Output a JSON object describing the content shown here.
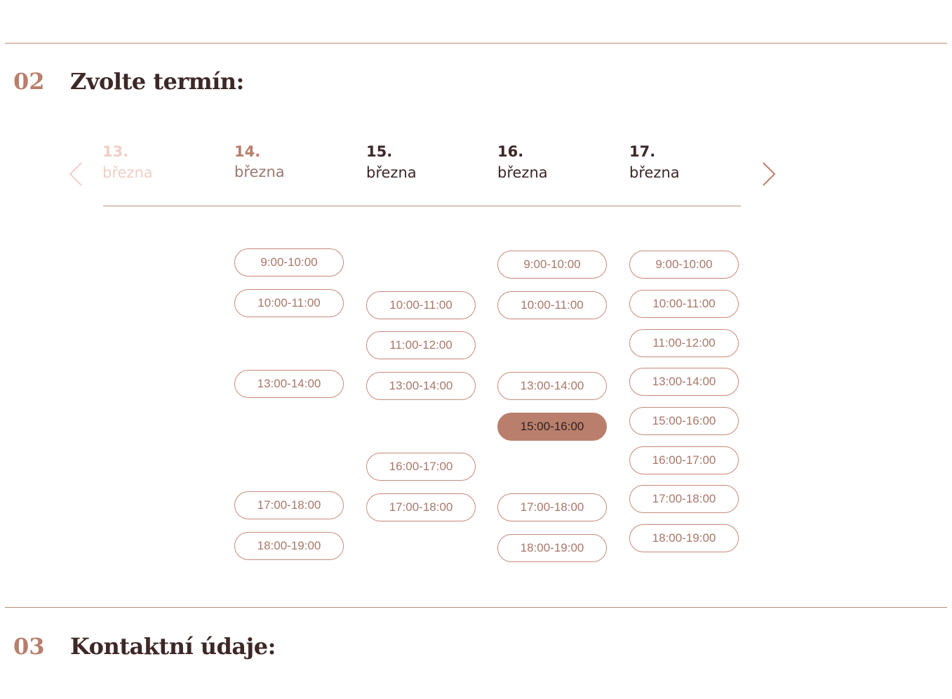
{
  "section2": {
    "number": "02",
    "title": "Zvolte termín:"
  },
  "section3": {
    "number": "03",
    "title": "Kontaktní údaje:"
  },
  "days": [
    {
      "num": "13.",
      "month": "března",
      "state": "disabled"
    },
    {
      "num": "14.",
      "month": "března",
      "state": "muted"
    },
    {
      "num": "15.",
      "month": "března",
      "state": "active"
    },
    {
      "num": "16.",
      "month": "března",
      "state": "active"
    },
    {
      "num": "17.",
      "month": "března",
      "state": "active"
    }
  ],
  "slots": {
    "day14": [
      "9:00-10:00",
      "10:00-11:00",
      "13:00-14:00",
      "17:00-18:00",
      "18:00-19:00"
    ],
    "day15": [
      "10:00-11:00",
      "11:00-12:00",
      "13:00-14:00",
      "16:00-17:00",
      "17:00-18:00"
    ],
    "day16": [
      "9:00-10:00",
      "10:00-11:00",
      "13:00-14:00",
      "15:00-16:00",
      "17:00-18:00",
      "18:00-19:00"
    ],
    "day17": [
      "9:00-10:00",
      "10:00-11:00",
      "11:00-12:00",
      "13:00-14:00",
      "15:00-16:00",
      "16:00-17:00",
      "17:00-18:00",
      "18:00-19:00"
    ]
  },
  "selected_slot": "16. března 15:00-16:00",
  "colors": {
    "accent": "#b97f6c",
    "text_dark": "#3d2727",
    "rule": "#b98a79",
    "disabled": "#f0cfc6"
  }
}
